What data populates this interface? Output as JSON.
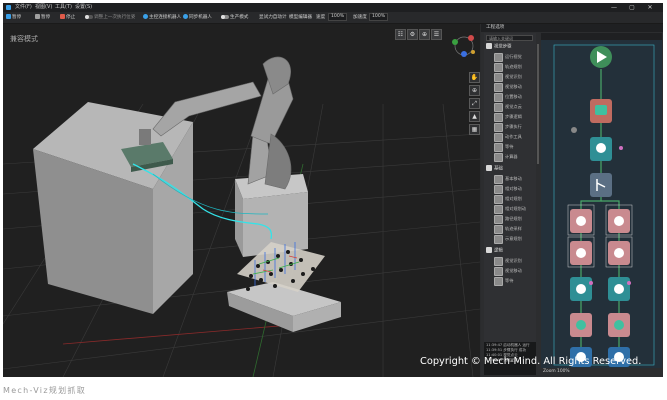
{
  "titlebar": {
    "menu": [
      "文件(F)",
      "视图(V)",
      "工具(T)",
      "设置(S)"
    ],
    "buttons": [
      "—",
      "▢",
      "✕"
    ]
  },
  "toolbar": {
    "items": [
      {
        "label": "暂停",
        "icon": "pause-icon",
        "color": "#3aa0e8"
      },
      {
        "label": "暂停",
        "icon": "pause-icon",
        "color": "#a0a0a0"
      },
      {
        "label": "停止",
        "icon": "stop-icon",
        "color": "#e05b4a"
      },
      {
        "label": "调整上一次执行位姿",
        "icon": "toggle-icon",
        "color": "#777777"
      },
      {
        "label": "主控连接机器人",
        "icon": "robot-icon",
        "color": "#3aa0e8"
      },
      {
        "label": "同步机器人",
        "icon": "sync-icon",
        "color": "#3aa0e8"
      },
      {
        "label": "生产模式",
        "icon": "toggle-icon",
        "color": "#e0e0e0"
      },
      {
        "label": "显试力自动计",
        "icon": "none",
        "color": "#bbbbbb"
      },
      {
        "label": "模型编辑器",
        "icon": "none",
        "color": "#bbbbbb"
      },
      {
        "label": "速度",
        "icon": "none",
        "color": "#bbbbbb"
      },
      {
        "label": "加速度",
        "icon": "none",
        "color": "#bbbbbb"
      }
    ],
    "speed_value": "100%",
    "accel_value": "100%"
  },
  "viewport": {
    "mode_label": "兼容模式",
    "top_tools": [
      "☷",
      "⚙",
      "⊕",
      "☰"
    ],
    "side_tools": [
      "✋",
      "⊕",
      "⤢",
      "▲",
      "▦"
    ]
  },
  "right_panel": {
    "header": "工程选项",
    "search_placeholder": "请输入关键词",
    "categories": [
      {
        "label": "视觉步骤",
        "items": [
          "运行视觉",
          "轨迹规划",
          "视觉识别",
          "视觉移动",
          "位置移动",
          "视觉点云",
          "步骤逻辑",
          "步骤执行",
          "动作工具",
          "等待",
          "计算器"
        ]
      },
      {
        "label": "基础",
        "items": [
          "基本移动",
          "相对移动",
          "相对规划",
          "相对规划动",
          "路径规划",
          "轨迹采样",
          "示意规划"
        ]
      },
      {
        "label": "逻辑",
        "items": [
          "视觉识别",
          "视觉移动",
          "等待"
        ]
      }
    ],
    "log_lines": [
      "11:39:47 启动机器人 运行",
      "11:39:51 步骤执行 成功",
      "11:40:01 视觉点云",
      "11:40:05 流程完成"
    ],
    "zoom_label": "Zoom 100%"
  },
  "watermark": "Copyright © Mech-Mind. All Rights Reserved.",
  "caption": "Mech-Viz规划抓取",
  "colors": {
    "accent": "#3aa0e8",
    "start_node": "#3f8f5a",
    "node_red": "#c06b60",
    "node_teal": "#2f8f95",
    "node_slate": "#5b6f84",
    "node_pink": "#c98a8f",
    "node_blue": "#2f6fa8",
    "flow_line": "#4aa86a"
  }
}
